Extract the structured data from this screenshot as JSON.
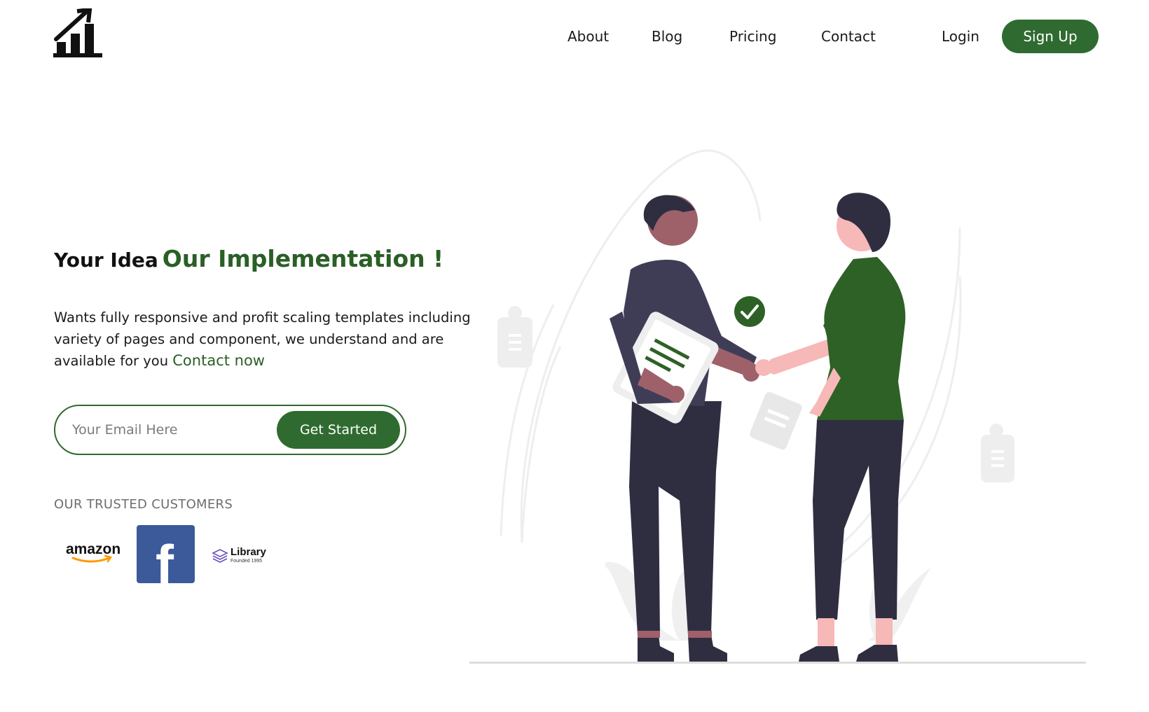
{
  "brand": {
    "logo_icon": "bar-chart-arrow-icon"
  },
  "nav": {
    "items": [
      {
        "label": "About"
      },
      {
        "label": "Blog"
      },
      {
        "label": "Pricing"
      },
      {
        "label": "Contact"
      }
    ],
    "login_label": "Login",
    "signup_label": "Sign Up"
  },
  "hero": {
    "title_prefix": "Your Idea",
    "title_highlight": "Our Implementation !",
    "description": "Wants fully responsive and profit scaling templates including variety of pages and component, we understand and are available for you",
    "contact_link": "Contact now"
  },
  "signup_form": {
    "email_placeholder": "Your Email Here",
    "button_label": "Get Started"
  },
  "customers": {
    "label": "OUR TRUSTED CUSTOMERS",
    "logos": [
      {
        "name": "amazon-logo",
        "text": "amazon"
      },
      {
        "name": "facebook-logo",
        "text": "f"
      },
      {
        "name": "library-logo",
        "text": "Library",
        "subtext": "Founded 1995"
      }
    ]
  },
  "colors": {
    "primary_green": "#2f6b30",
    "title_green": "#2a5f26",
    "shirt_green": "#2e6126",
    "dark_figure": "#2f2e41",
    "facebook_blue": "#3c5a99",
    "amazon_orange": "#ff9900",
    "library_purple": "#6b4fbf"
  }
}
